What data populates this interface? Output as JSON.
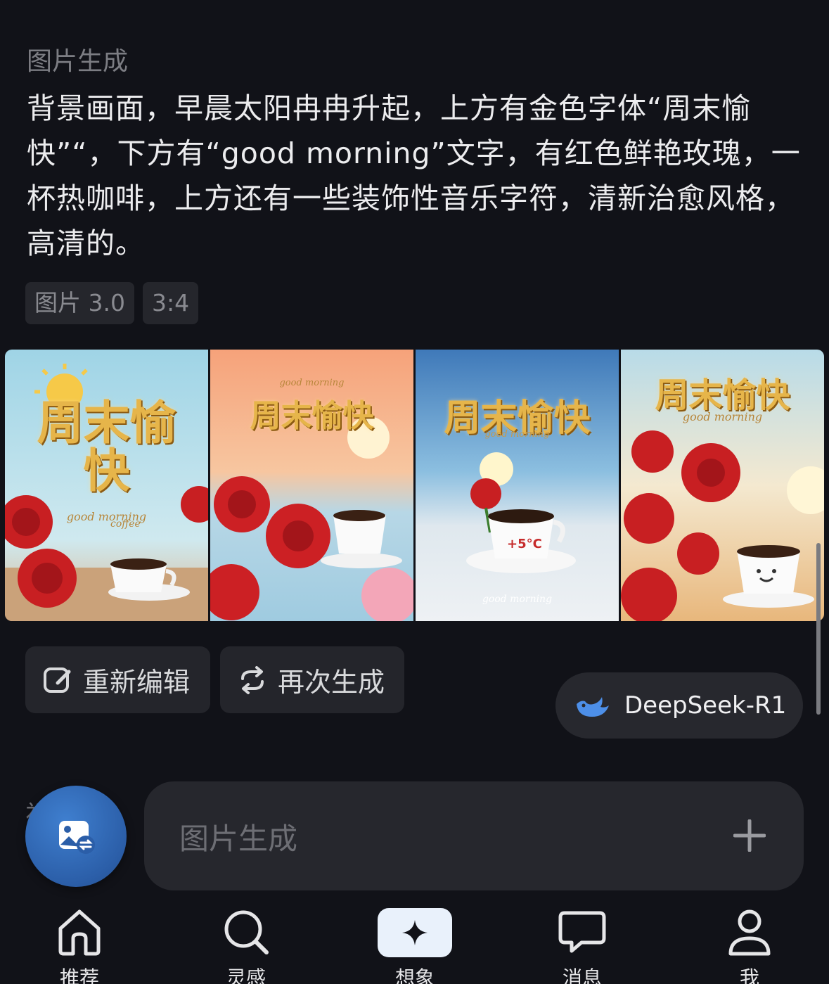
{
  "section": {
    "label": "图片生成"
  },
  "prompt": {
    "text": "背景画面，早晨太阳冉冉升起，上方有金色字体“周末愉快”“，下方有“good morning”文字，有红色鲜艳玫瑰，一杯热咖啡，上方还有一些装饰性音乐字符，清新治愈风格，高清的。"
  },
  "tags": {
    "model": "图片 3.0",
    "ratio": "3:4"
  },
  "images": [
    {
      "title": "周末愉快",
      "sub": "good morning",
      "extra": "coffee"
    },
    {
      "title": "周末愉快",
      "sub": "good morning"
    },
    {
      "title": "周末愉快",
      "sub": "good morning",
      "temp": "+5°C",
      "bottom": "good morning"
    },
    {
      "title": "周末愉快",
      "sub": "good morning"
    }
  ],
  "actions": {
    "edit": "重新编辑",
    "regenerate": "再次生成"
  },
  "model": {
    "name": "DeepSeek-R1",
    "icon": "whale-icon"
  },
  "behind": {
    "text": "视  成"
  },
  "input": {
    "placeholder": "图片生成"
  },
  "tabs": [
    {
      "label": "推荐",
      "icon": "home-icon"
    },
    {
      "label": "灵感",
      "icon": "search-icon"
    },
    {
      "label": "想象",
      "icon": "sparkle-icon"
    },
    {
      "label": "消息",
      "icon": "message-icon"
    },
    {
      "label": "我",
      "icon": "profile-icon"
    }
  ],
  "colors": {
    "background": "#111218",
    "accent": "#2b5ea8",
    "gold": "#e6b54a"
  }
}
